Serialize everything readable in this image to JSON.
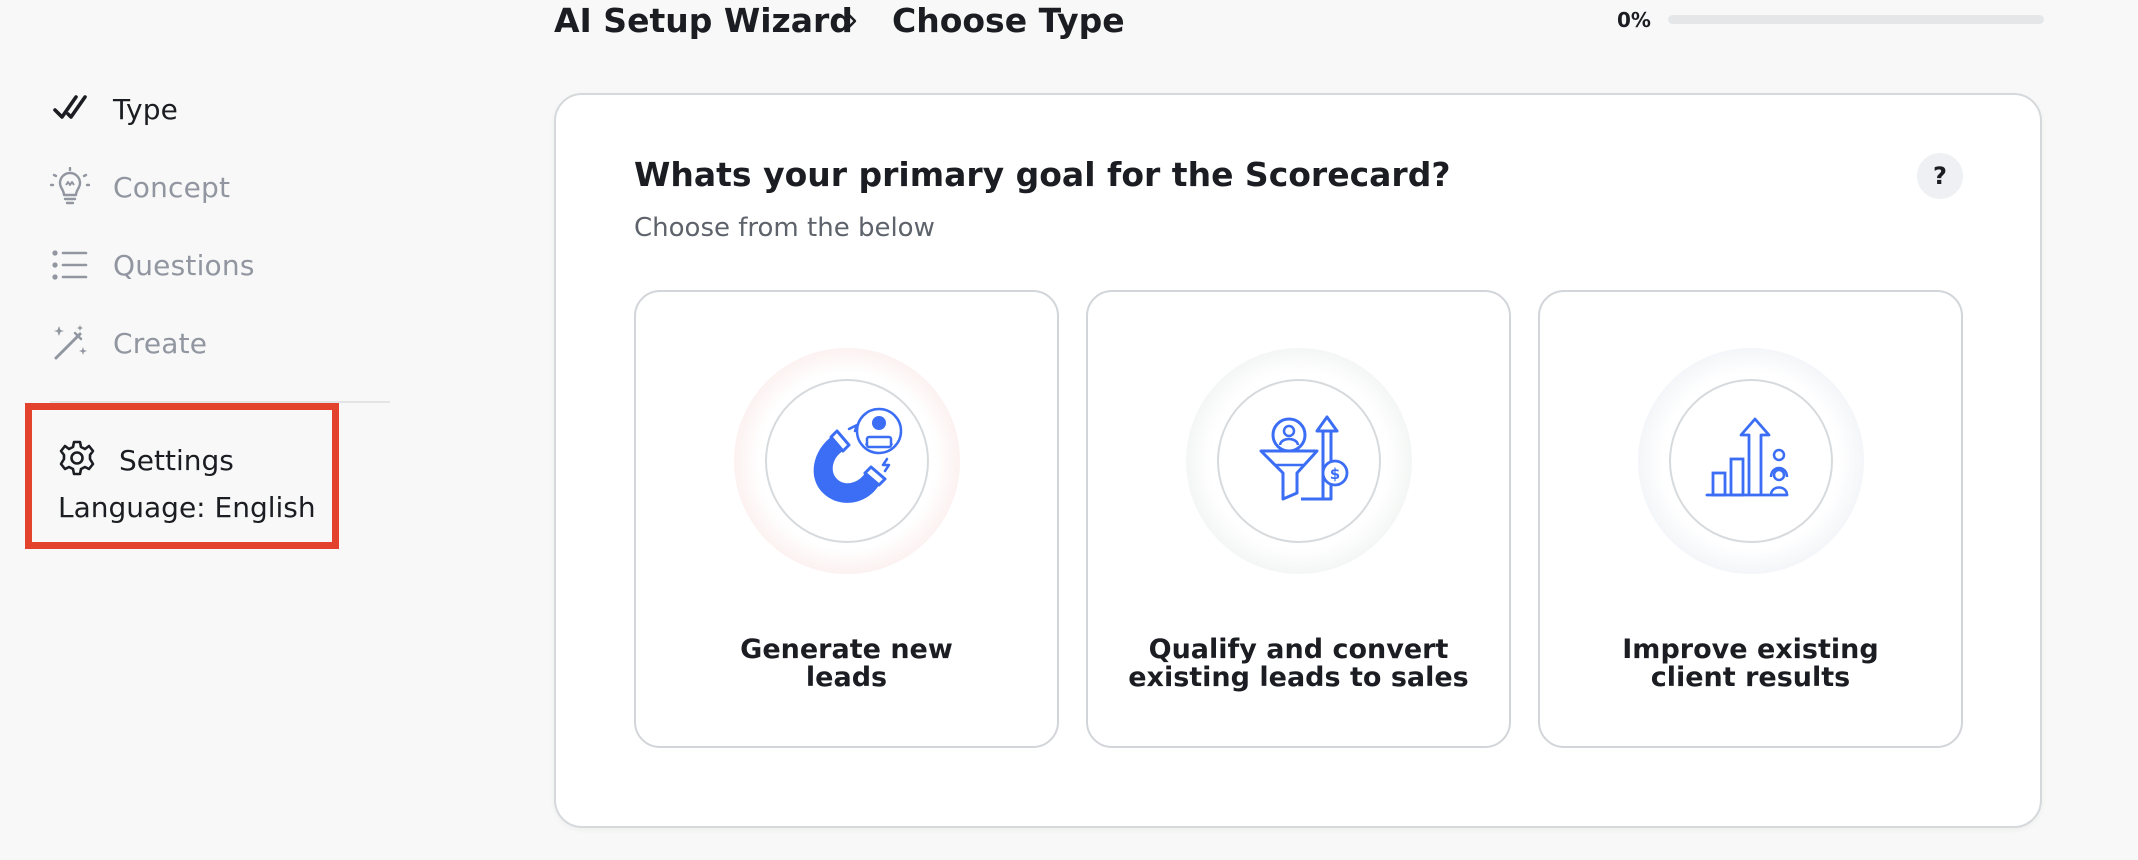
{
  "sidebar": {
    "items": [
      {
        "label": "Type",
        "icon": "double-check-icon",
        "state": "active"
      },
      {
        "label": "Concept",
        "icon": "lightbulb-icon",
        "state": "inactive"
      },
      {
        "label": "Questions",
        "icon": "list-icon",
        "state": "inactive"
      },
      {
        "label": "Create",
        "icon": "magic-wand-icon",
        "state": "inactive"
      }
    ],
    "settings": {
      "label": "Settings",
      "icon": "gear-icon"
    },
    "language": "Language: English"
  },
  "header": {
    "breadcrumb": [
      "AI Setup Wizard",
      "Choose Type"
    ],
    "progress_label": "0%",
    "progress_value": 0
  },
  "main": {
    "title": "Whats your primary goal for the Scorecard?",
    "subtitle": "Choose from the below",
    "help_label": "?",
    "options": [
      {
        "line1": "Generate new",
        "line2": "leads",
        "icon": "magnet-lead-icon"
      },
      {
        "line1": "Qualify and convert",
        "line2": "existing leads to sales",
        "icon": "funnel-conversion-icon"
      },
      {
        "line1": "Improve existing",
        "line2": "client results",
        "icon": "growth-chart-icon"
      }
    ]
  },
  "colors": {
    "accent": "#3b6ef5",
    "highlight_border": "#e3432d",
    "halo_1": "#fbf0ef",
    "halo_2": "#f2f5f3",
    "halo_3": "#f2f4f8"
  }
}
